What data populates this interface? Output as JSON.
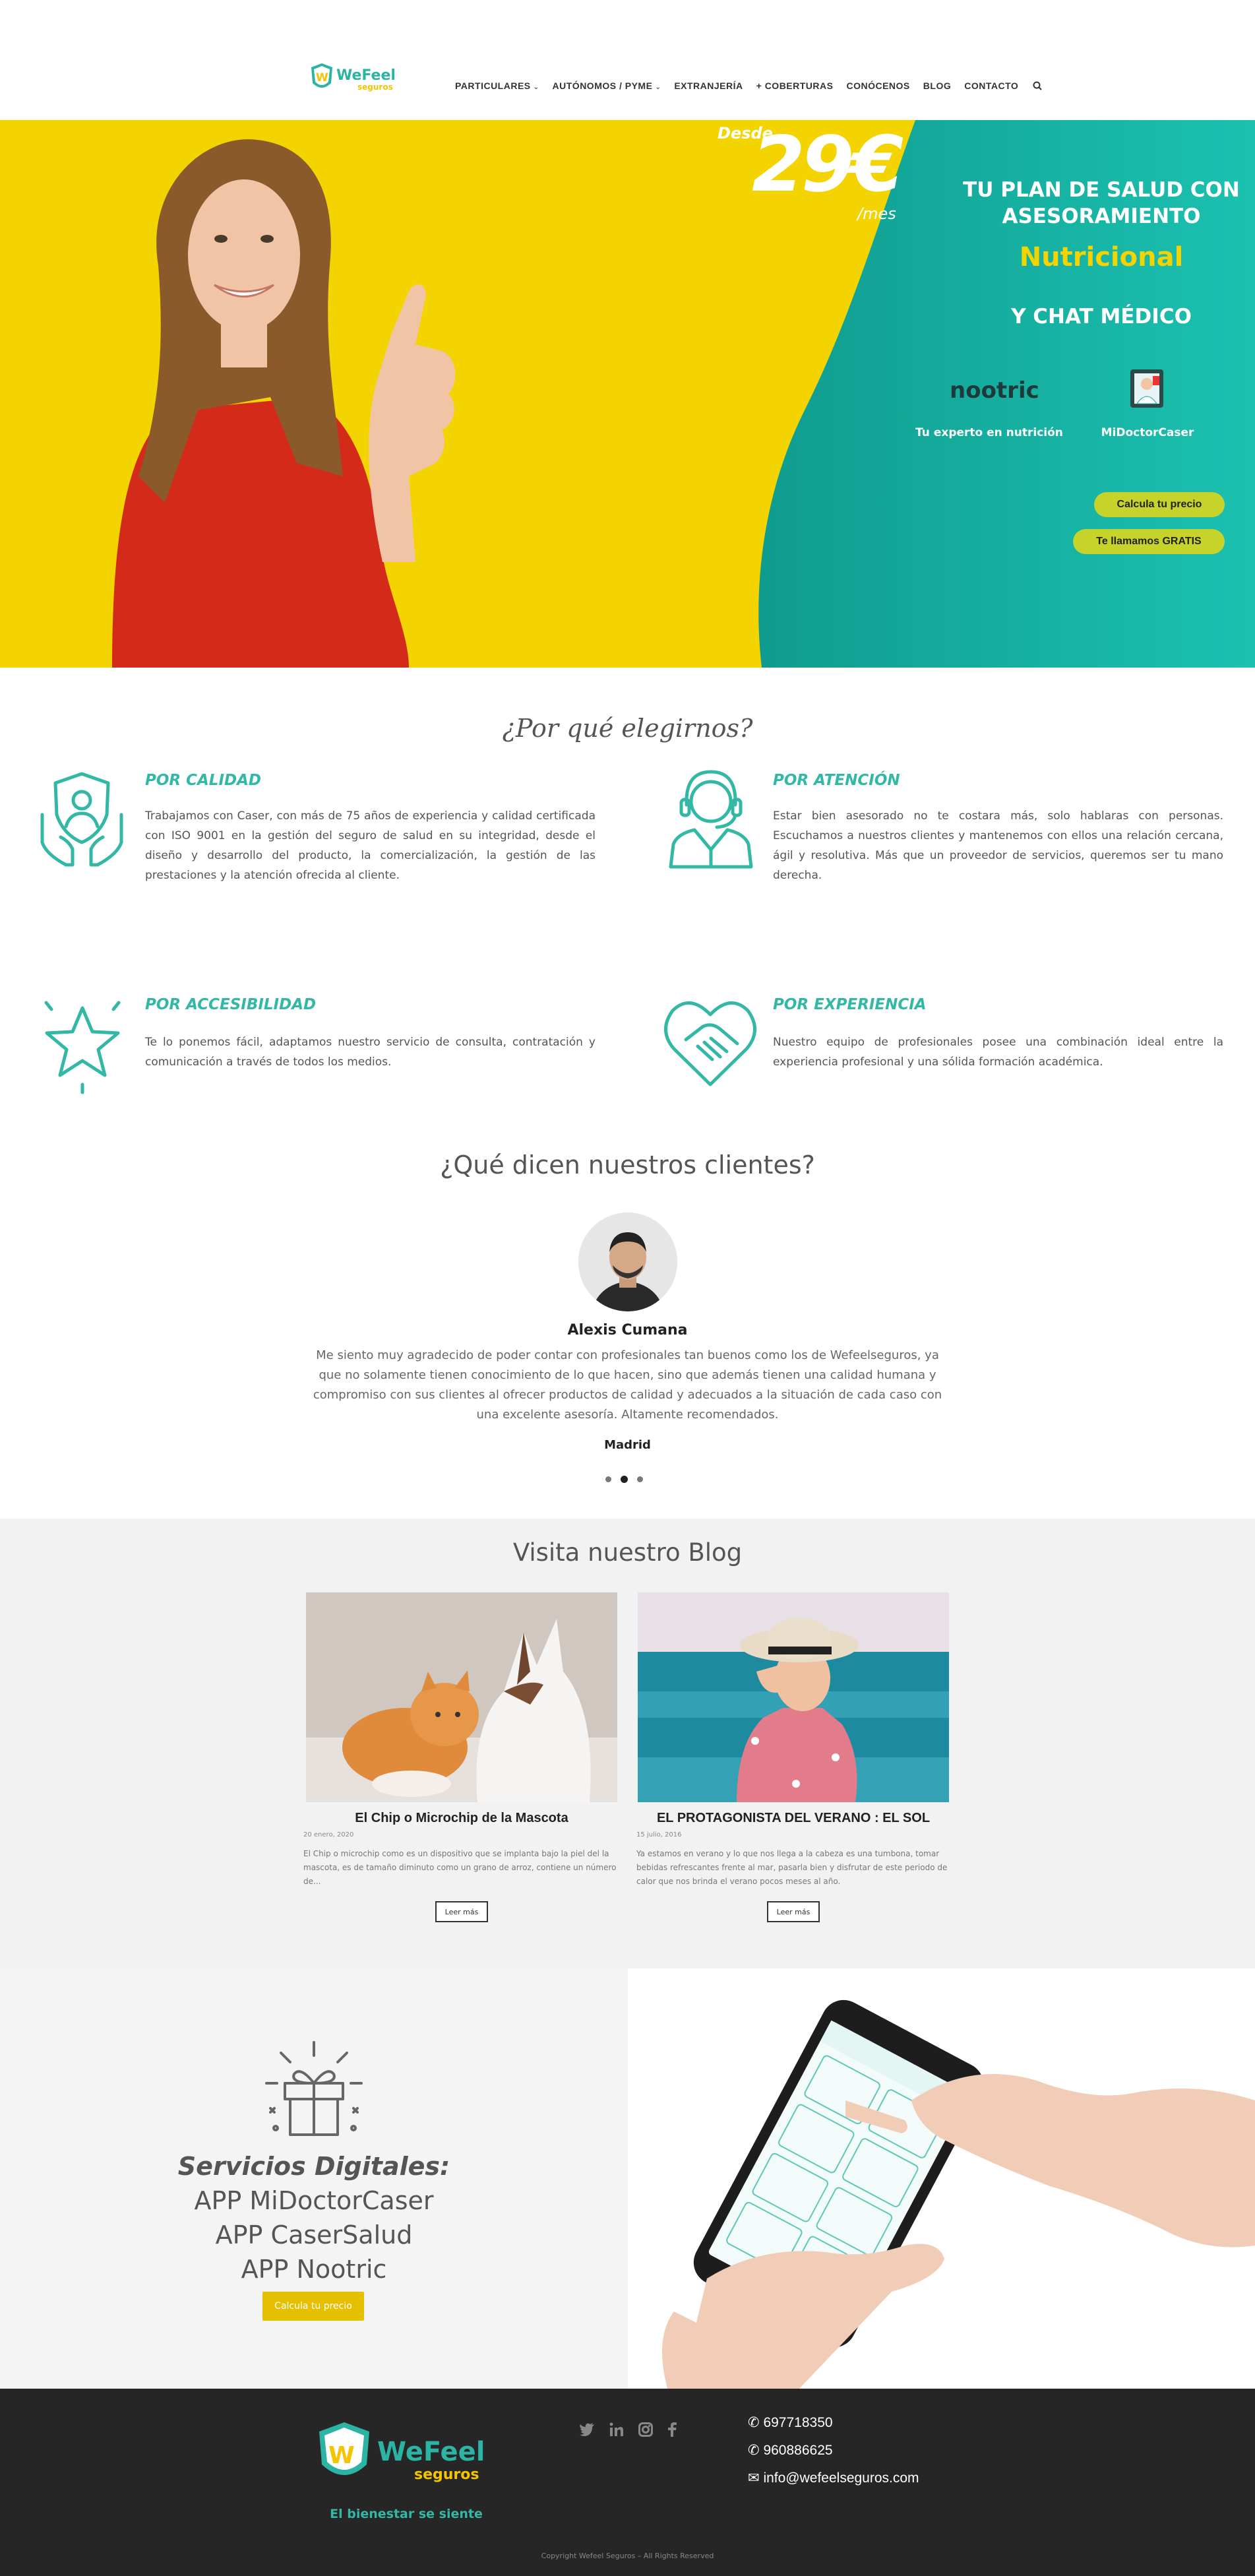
{
  "brand": {
    "name_1": "WeFeel",
    "name_2": "seguros"
  },
  "nav": {
    "items": [
      {
        "label": "PARTICULARES",
        "dropdown": true
      },
      {
        "label": "AUTÓNOMOS / PYME",
        "dropdown": true
      },
      {
        "label": "EXTRANJERÍA",
        "dropdown": false
      },
      {
        "label": "+ COBERTURAS",
        "dropdown": false
      },
      {
        "label": "CONÓCENOS",
        "dropdown": false
      },
      {
        "label": "BLOG",
        "dropdown": false
      },
      {
        "label": "CONTACTO",
        "dropdown": false
      }
    ],
    "search_icon": "search-icon"
  },
  "hero": {
    "price_from": "Desde",
    "price": "29€",
    "price_unit": "/mes",
    "headline": "TU PLAN DE SALUD CON ASESORAMIENTO",
    "highlight": "Nutricional",
    "subline": "Y CHAT MÉDICO",
    "nootric_logo": "nootric",
    "nootric_caption": "Tu experto en nutrición",
    "doctor_caption": "MiDoctorCaser",
    "btn_price": "Calcula tu precio",
    "btn_call": "Te llamamos GRATIS",
    "colors": {
      "yellow": "#f4d400",
      "teal": "#15b5a3",
      "button": "#c6d32a"
    }
  },
  "why": {
    "title": "¿Por qué elegirnos?",
    "features": [
      {
        "title": "POR CALIDAD",
        "text": "Trabajamos con Caser, con más de 75 años de experiencia y calidad certificada con ISO 9001 en la gestión del seguro de salud en su integridad, desde el diseño y desarrollo del producto, la comercialización, la gestión de las prestaciones y la atención ofrecida al cliente.",
        "icon": "shield-hands-icon"
      },
      {
        "title": "POR ATENCIÓN",
        "text": "Estar bien asesorado no te costara más, solo hablaras con personas. Escuchamos a nuestros clientes y mantenemos con ellos una relación cercana, ágil y resolutiva. Más que un proveedor de servicios, queremos ser tu mano derecha.",
        "icon": "headset-agent-icon"
      },
      {
        "title": "POR ACCESIBILIDAD",
        "text": "Te lo ponemos fácil, adaptamos nuestro servicio de consulta, contratación y comunicación a través de todos los medios.",
        "icon": "star-icon"
      },
      {
        "title": "POR  EXPERIENCIA",
        "text": "Nuestro equipo de profesionales posee una combinación ideal entre la experiencia profesional y una sólida formación académica.",
        "icon": "heart-handshake-icon"
      }
    ]
  },
  "testimonials": {
    "title": "¿Qué dicen nuestros clientes?",
    "name": "Alexis Cumana",
    "text": "Me siento muy agradecido de poder contar con profesionales tan buenos como los de Wefeelseguros, ya que no solamente tienen conocimiento de lo que hacen, sino que además tienen una calidad humana y compromiso con sus clientes al ofrecer productos de calidad y adecuados a la situación de cada caso con una excelente asesoría. Altamente recomendados.",
    "city": "Madrid",
    "slides": 3,
    "active_slide": 2
  },
  "blog": {
    "title": "Visita nuestro Blog",
    "posts": [
      {
        "title": "El Chip o Microchip de la Mascota",
        "date": "20 enero, 2020",
        "excerpt": "El Chip o microchip como es un dispositivo que se implanta bajo la piel del la mascota, es de tamaño diminuto como un grano de arroz, contiene un número de...",
        "read_more": "Leer más"
      },
      {
        "title": "EL PROTAGONISTA DEL VERANO : EL SOL",
        "date": "15 julio, 2016",
        "excerpt": "Ya estamos en verano y lo que nos llega a la cabeza es una tumbona, tomar bebidas refrescantes frente al mar, pasarla bien y disfrutar de este periodo de calor que nos brinda el verano pocos meses al año.",
        "read_more": "Leer más"
      }
    ]
  },
  "digital": {
    "title": "Servicios Digitales:",
    "apps": [
      "APP MiDoctorCaser",
      "APP CaserSalud",
      "APP Nootric"
    ],
    "button": "Calcula tu precio"
  },
  "footer": {
    "tagline": "El bienestar se siente",
    "socials": [
      "twitter-icon",
      "linkedin-icon",
      "instagram-icon",
      "facebook-icon"
    ],
    "phone_1": "697718350",
    "phone_2": "960886625",
    "email": "info@wefeelseguros.com",
    "copyright": "Copyright Wefeel Seguros – All Rights Reserved"
  }
}
